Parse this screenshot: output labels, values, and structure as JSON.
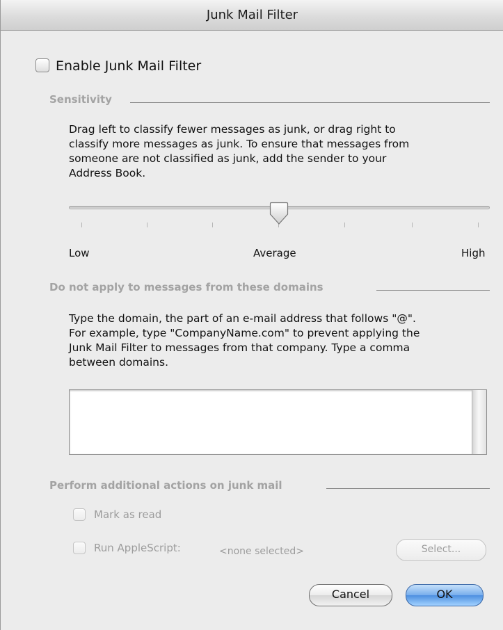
{
  "window": {
    "title": "Junk Mail Filter"
  },
  "enable": {
    "label": "Enable Junk Mail Filter",
    "checked": false
  },
  "sensitivity": {
    "title": "Sensitivity",
    "description_lines": [
      "Drag left to classify fewer messages as junk, or drag right to",
      "classify more messages as junk. To ensure that messages from",
      "someone are not classified as junk, add the sender to your",
      "Address Book."
    ],
    "slider": {
      "value_fraction": 0.5,
      "tick_count": 7
    },
    "low_label": "Low",
    "average_label": "Average",
    "high_label": "High"
  },
  "domains": {
    "title": "Do not apply to messages from these domains",
    "description_lines": [
      "Type the domain, the part of an e-mail address that follows \"@\".",
      "For example, type \"CompanyName.com\" to prevent applying the",
      "Junk Mail Filter to messages from that company. Type a comma",
      "between domains."
    ],
    "value": ""
  },
  "actions": {
    "title": "Perform additional actions on junk mail",
    "mark_as_read_label": "Mark as read",
    "run_applescript_label": "Run AppleScript:",
    "applescript_value": "<none selected>",
    "select_button": "Select..."
  },
  "buttons": {
    "cancel": "Cancel",
    "ok": "OK"
  },
  "colors": {
    "ok_blue": "#5a9ae6",
    "section_gray": "#a3a3a3",
    "window_bg": "#ececec"
  }
}
